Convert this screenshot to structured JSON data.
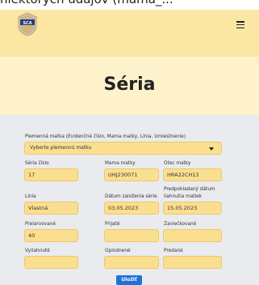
{
  "page_top_fragment": "niektorých údajov (mamá_...",
  "header": {
    "logo_text": "SCA",
    "menu_icon": "hamburger-icon"
  },
  "page": {
    "title": "Séria"
  },
  "form": {
    "queen_select": {
      "label": "Plemenná matka (Evidenčné číslo, Mama matky, Línia, Umiestnenie)",
      "value": "Vyberte plemennú matku"
    },
    "serial_number": {
      "label": "Séria číslo",
      "value": "17"
    },
    "queen_mother": {
      "label": "Mama matky",
      "value": "UHJ230071"
    },
    "queen_father": {
      "label": "Otec matky",
      "value": "HRA22CH13"
    },
    "line": {
      "label": "Línia",
      "value": "Vlastná"
    },
    "creation_date": {
      "label": "Dátum založenia série",
      "value": "03.05.2023"
    },
    "expected_hatch_date": {
      "label_line1": "Predpokladaný dátum",
      "label_line2": "liahnutia matiek",
      "value": "15.05.2023"
    },
    "transferred": {
      "label": "Prelarvované",
      "value": "40"
    },
    "accepted": {
      "label": "Prijaté",
      "value": ""
    },
    "capped": {
      "label": "Zaviečkované",
      "value": ""
    },
    "hatched": {
      "label": "Vyliahnuté",
      "value": ""
    },
    "mated": {
      "label": "Oplodnené",
      "value": ""
    },
    "sold": {
      "label": "Predané",
      "value": ""
    },
    "save_label": "Uložiť"
  },
  "colors": {
    "navbar_bg": "#fbe7a3",
    "title_bg": "#fdf2cc",
    "form_bg": "#eaebef",
    "input_bg": "#fbdf90",
    "button_bg": "#1e72d6"
  }
}
